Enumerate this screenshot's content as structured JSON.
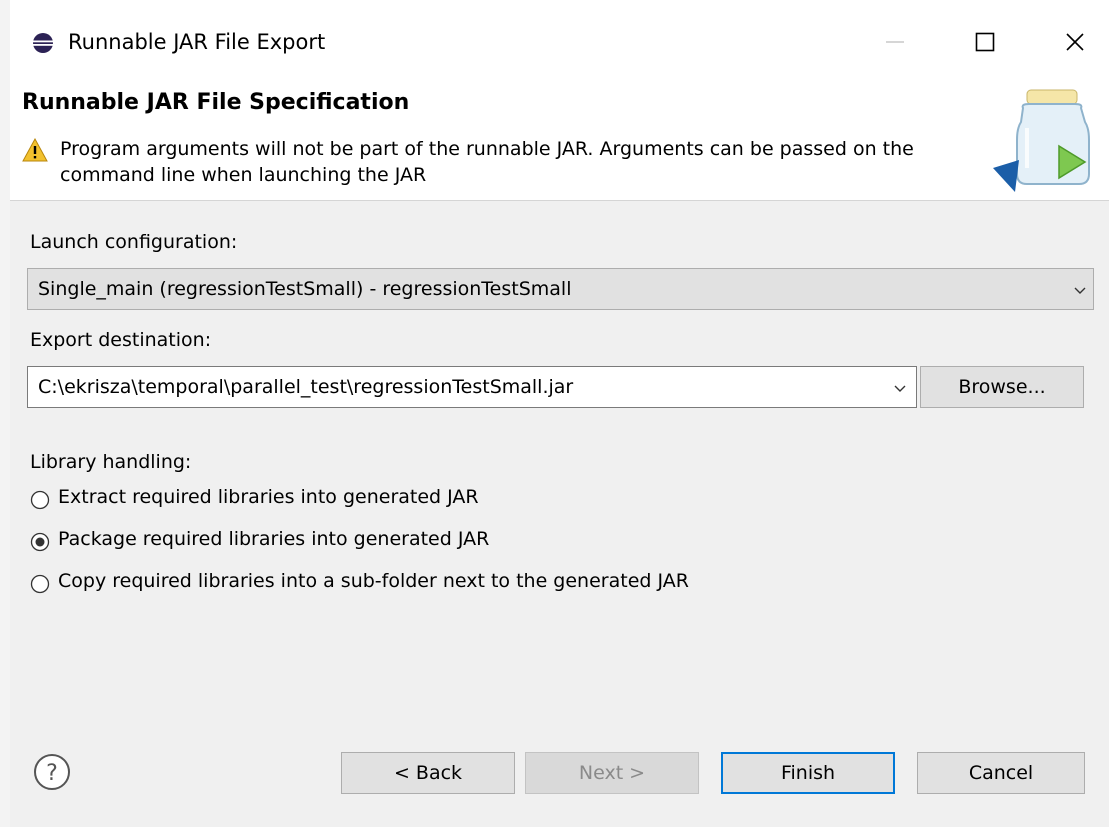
{
  "window": {
    "title": "Runnable JAR File Export",
    "icon": "eclipse-icon",
    "controls": {
      "minimize": "minimize-icon",
      "maximize": "maximize-icon",
      "close": "close-icon"
    }
  },
  "banner": {
    "title": "Runnable JAR File Specification",
    "message": "Program arguments will not be part of the runnable JAR. Arguments can be passed on the command line when launching the JAR",
    "icon": "warning-icon",
    "image": "jar-export-icon"
  },
  "launch": {
    "label": "Launch configuration:",
    "value": "Single_main (regressionTestSmall) - regressionTestSmall"
  },
  "destination": {
    "label": "Export destination:",
    "value": "C:\\ekrisza\\temporal\\parallel_test\\regressionTestSmall.jar",
    "browse_label": "Browse..."
  },
  "library": {
    "label": "Library handling:",
    "options": [
      {
        "label": "Extract required libraries into generated JAR",
        "selected": false
      },
      {
        "label": "Package required libraries into generated JAR",
        "selected": true
      },
      {
        "label": "Copy required libraries into a sub-folder next to the generated JAR",
        "selected": false
      }
    ]
  },
  "footer": {
    "help_icon": "help-icon",
    "back_label": "< Back",
    "next_label": "Next >",
    "finish_label": "Finish",
    "cancel_label": "Cancel"
  },
  "colors": {
    "accent": "#0078d7",
    "warning": "#f2c12e"
  }
}
